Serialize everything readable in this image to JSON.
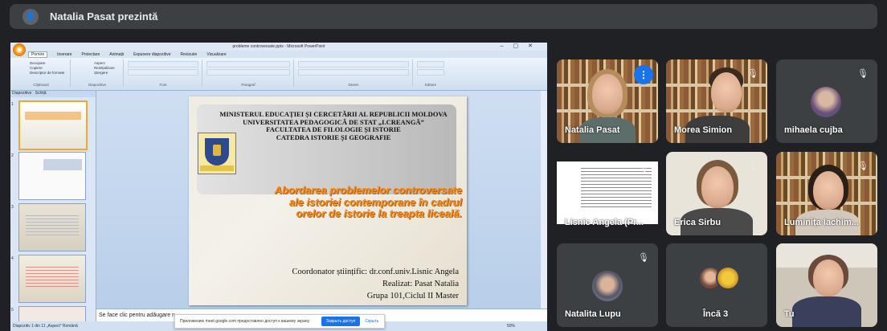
{
  "topbar": {
    "presenter_text": "Natalia Pasat prezintă"
  },
  "powerpoint": {
    "window_title": "probleme controversate.pptx - Microsoft PowerPoint",
    "ribbon_tabs": [
      "Pornire",
      "Inserare",
      "Proiectare",
      "Animații",
      "Expunere diapozitive",
      "Revizuire",
      "Vizualizare"
    ],
    "ribbon_groups": [
      "Clipboard",
      "Diapozitive",
      "Font",
      "Paragraf",
      "Desen",
      "Editare"
    ],
    "clipboard_items": [
      "Decupare",
      "Copiere",
      "Descriptor de formate"
    ],
    "slide_items": [
      "Aspect",
      "Reinițializare",
      "Ștergere"
    ],
    "pane_tabs": [
      "Diapozitive",
      "Schiță"
    ],
    "slide_numbers": [
      "1",
      "2",
      "3",
      "4",
      "5"
    ],
    "slide": {
      "header": [
        "MINISTERUL EDUCAȚIEI ȘI CERCETĂRII AL REPUBLICII MOLDOVA",
        "UNIVERSITATEA PEDAGOGICĂ DE STAT „I.CREANGĂ”",
        "FACULTATEA DE FILOLOGIE ȘI ISTORIE",
        "CATEDRA ISTORIE ȘI GEOGRAFIE"
      ],
      "topic": [
        "Abordarea problemelor controversate",
        "ale istoriei contemporane în cadrul",
        "orelor de istorie la treapta liceală."
      ],
      "coordinator": "Coordonator științific: dr.conf.univ.Lisnic Angela",
      "author": "Realizat: Pasat Natalia",
      "group": "Grupa 101,Ciclul II Master"
    },
    "notes_placeholder": "Se face clic pentru adăugare n",
    "status_text": "Diapozitiv 1 din 11   „Aspect”   Română",
    "zoom": "50%"
  },
  "infobar": {
    "text": "Приложению meet.google.com предоставлен доступ к вашему экрану.",
    "stop_button": "Закрыть доступ",
    "hide_button": "Скрыть"
  },
  "participants": [
    {
      "name": "Natalia Pasat",
      "speaking": true
    },
    {
      "name": "Morea Simion",
      "muted": true
    },
    {
      "name": "mihaela cujba",
      "muted": true
    },
    {
      "name": "Lisnic Angela (Pr...",
      "muted": true
    },
    {
      "name": "Erica Sirbu",
      "muted": true
    },
    {
      "name": "Luminița Iachim...",
      "muted": true
    },
    {
      "name": "Natalita Lupu",
      "muted": true
    },
    {
      "name": "Încă 3"
    },
    {
      "name": "Tu"
    }
  ],
  "colors": {
    "accent": "#1a73e8",
    "active_outline": "#8ab4f8",
    "background": "#202124",
    "tile": "#3c4043",
    "slide_topic": "#f28a1e"
  }
}
